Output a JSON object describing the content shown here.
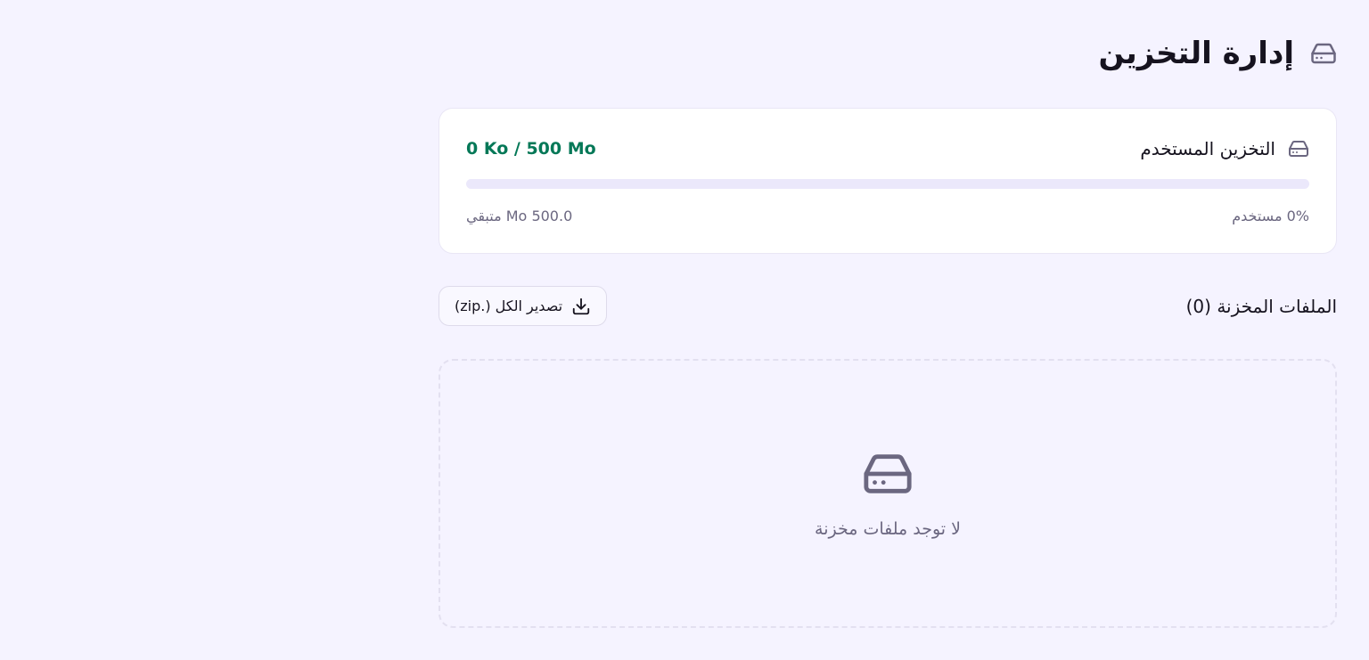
{
  "header": {
    "title": "إدارة التخزين",
    "icon": "hard-drive-icon"
  },
  "storage": {
    "title": "التخزين المستخدم",
    "icon": "hard-drive-icon",
    "usage_text": "0 Ko / 500 Mo",
    "used_percent": 0,
    "used_label": "0% مستخدم",
    "remaining_label": "500.0 Mo متبقي"
  },
  "files": {
    "title": "الملفات المخزنة (0)",
    "export_label": "تصدير الكل (.zip)",
    "export_icon": "download-icon"
  },
  "empty_state": {
    "icon": "hard-drive-icon",
    "message": "لا توجد ملفات مخزنة"
  },
  "colors": {
    "accent_green": "#047857",
    "background": "#f5f3ff",
    "progress_track": "#ebe8fb",
    "muted_text": "#6b6780"
  }
}
